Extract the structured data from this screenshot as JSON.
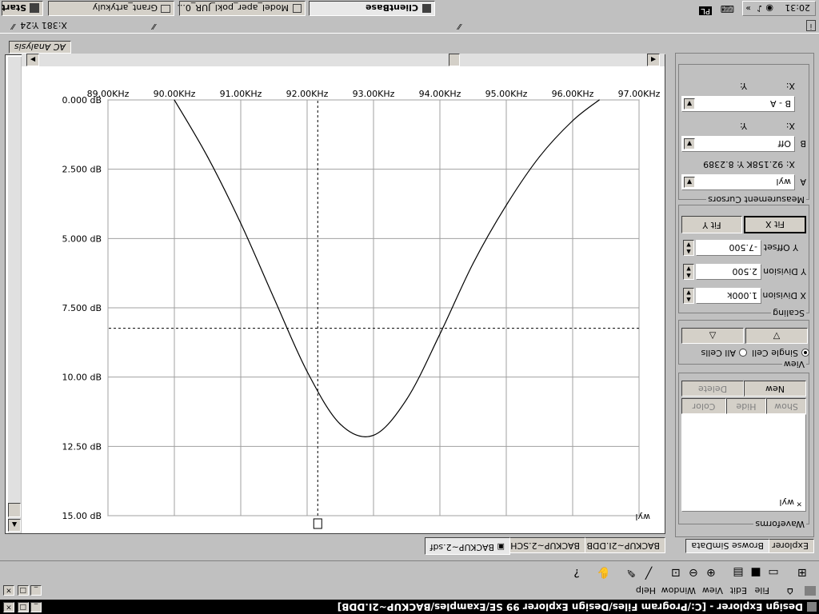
{
  "titlebar": {
    "title": "Design Explorer - [C:/Program Files/Design Explorer 99 SE/Examples/BACKUP~2I.DDB]"
  },
  "menu": [
    "File",
    "Edit",
    "View",
    "Window",
    "Help"
  ],
  "toolbar_icons": [
    "tree-icon",
    "open-icon",
    "save-icon",
    "print-icon",
    "zoom-in-icon",
    "zoom-out-icon",
    "zoom-fit-icon",
    "wire-icon",
    "probe-icon",
    "hand-icon",
    "help-icon"
  ],
  "left_panel": {
    "tabs": [
      "Explorer",
      "Browse SimData"
    ],
    "waveforms": {
      "label": "Waveforms",
      "items": [
        "wyl"
      ],
      "buttons": {
        "show": "Show",
        "hide": "Hide",
        "color": "Color",
        "new": "New",
        "delete": "Delete"
      }
    },
    "view": {
      "label": "View",
      "single_cell": "Single Cell",
      "all_cells": "All Cells"
    },
    "scaling": {
      "label": "Scaling",
      "x_division_label": "X Division",
      "x_division": "1.000k",
      "y_division_label": "Y Division",
      "y_division": "2.500",
      "y_offset_label": "Y Offset",
      "y_offset": "-7.500",
      "fit_x": "Fit X",
      "fit_y": "Fit Y"
    },
    "cursors": {
      "label": "Measurement Cursors",
      "a_label": "A",
      "a_value": "wyl",
      "a_readout": "X: 92.158K  Y: 8.2389",
      "x_label": "X:",
      "y_label": "Y:",
      "b_label": "B",
      "b_value": "Off",
      "diff_value": "B - A"
    }
  },
  "status": {
    "coords": "X:381 Y:24"
  },
  "doc_tabs": [
    "BACKUP~2I.DDB",
    "BACKUP~2.SCH",
    "BACKUP~2.sdf"
  ],
  "analysis_tab": "AC Analysis",
  "taskbar": {
    "start": "Start",
    "items": [
      "Grant_artykuly",
      "Model_aper_pokl_JUR_0...",
      "ClientBase"
    ],
    "lang": "PL",
    "clock": "20:31"
  },
  "chart_data": {
    "type": "line",
    "series_label": "wyl",
    "x_ticks": [
      "89.00KHz",
      "90.00KHz",
      "91.00KHz",
      "92.00KHz",
      "93.00KHz",
      "94.00KHz",
      "95.00KHz",
      "96.00KHz",
      "97.00KHz"
    ],
    "y_ticks": [
      "0.000 dB",
      "2.500 dB",
      "5.000 dB",
      "7.500 dB",
      "10.00 dB",
      "12.50 dB",
      "15.00 dB"
    ],
    "xlim": [
      89.0,
      97.0
    ],
    "ylim": [
      0,
      15
    ],
    "grid": true,
    "x": [
      90.0,
      90.5,
      91.0,
      91.5,
      92.0,
      92.5,
      93.0,
      93.5,
      94.0,
      94.5,
      95.0,
      95.5,
      96.0,
      96.4
    ],
    "values": [
      0.0,
      2.05,
      4.45,
      7.15,
      9.8,
      11.7,
      12.1,
      10.8,
      8.45,
      5.9,
      3.8,
      2.05,
      0.75,
      0.0
    ],
    "cursor_x": 92.16,
    "cursor_y": 8.24
  }
}
